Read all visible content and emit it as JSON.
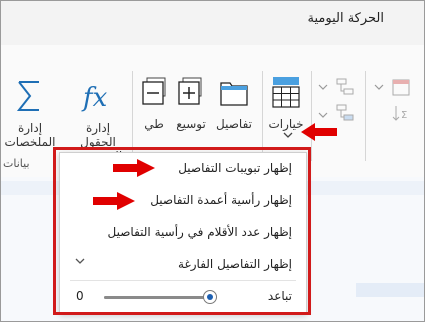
{
  "window": {
    "title": "الحركة اليومية"
  },
  "ribbon": {
    "buttons": {
      "manage_summary": "إدارة\nالملخصات",
      "manage_calculated": "إدارة الحقول\nالمحسوبة",
      "collapse": "طي",
      "expand": "توسيع",
      "details": "تفاصيل",
      "options": "خيارات"
    },
    "group_label": "بيانات"
  },
  "menu": {
    "items": [
      {
        "label": "إظهار تبويبات التفاصيل"
      },
      {
        "label": "إظهار رأسية أعمدة التفاصيل"
      },
      {
        "label": "إظهار عدد الأقلام في رأسية التفاصيل"
      },
      {
        "label": "إظهار التفاصيل الفارغة"
      }
    ],
    "spacing": {
      "label": "تباعد",
      "value": "0",
      "level": 0.95
    }
  },
  "colors": {
    "accent": "#1c5fb2",
    "highlight": "#d11a1a",
    "icon_blue": "#1f6fb5"
  }
}
